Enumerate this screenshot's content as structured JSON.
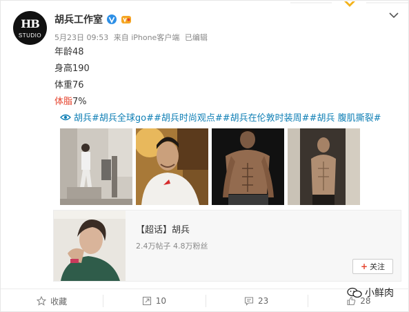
{
  "post": {
    "author": "胡兵工作室",
    "avatar_logo": "HB",
    "avatar_sub": "STUDIO",
    "date": "5月23日 09:53",
    "source": "来自 iPhone客户端",
    "edited": "已编辑",
    "lines": [
      "年龄48",
      "身高190",
      "体重76"
    ],
    "bodyfat_label": "体脂",
    "bodyfat_value": "7%",
    "tags": "胡兵#胡兵全球go##胡兵时尚观点##胡兵在伦敦时装周##胡兵 腹肌撕裂#",
    "icons": {
      "verified": "verified-v-icon",
      "vip": "vip-icon",
      "more": "chevron-down-icon",
      "tag": "eye-icon"
    }
  },
  "topic": {
    "title": "【超话】胡兵",
    "stats": "2.4万帖子 4.8万粉丝",
    "follow_label": "关注"
  },
  "actions": {
    "favorite": "收藏",
    "repost": "10",
    "comment": "23",
    "like": "28"
  },
  "watermark": "小鲜肉",
  "colors": {
    "accent_red": "#e5432d",
    "link_blue": "#0f7fb5",
    "verified_blue": "#2d8fe6",
    "vip_orange": "#f5a623"
  }
}
